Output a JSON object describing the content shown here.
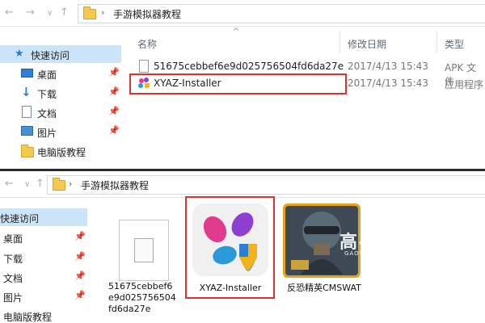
{
  "top": {
    "breadcrumb": {
      "separator": "›",
      "folder": "手游模拟器教程"
    },
    "sidebar": [
      {
        "label": "快速访问",
        "icon": "star-icon",
        "selected": true
      },
      {
        "label": "桌面",
        "icon": "desktop-icon",
        "pinned": true
      },
      {
        "label": "下载",
        "icon": "download-icon",
        "pinned": true
      },
      {
        "label": "文档",
        "icon": "document-icon",
        "pinned": true
      },
      {
        "label": "图片",
        "icon": "pictures-icon",
        "pinned": true
      },
      {
        "label": "电脑版教程",
        "icon": "folder-icon",
        "pinned": false
      }
    ],
    "columns": {
      "name": "名称",
      "date": "修改日期",
      "type": "类型"
    },
    "files": [
      {
        "name": "51675cebbef6e9d025756504fd6da27e",
        "date": "2017/4/13 15:43",
        "type": "APK 文件",
        "icon": "blank-file-icon"
      },
      {
        "name": "XYAZ-Installer",
        "date": "2017/4/13 15:43",
        "type": "应用程序",
        "icon": "xyaz-app-icon",
        "highlighted": true
      }
    ]
  },
  "bottom": {
    "breadcrumb": {
      "separator": "›",
      "folder": "手游模拟器教程"
    },
    "sidebar": [
      {
        "label": "快速访问",
        "selected": true
      },
      {
        "label": "桌面",
        "pinned": true
      },
      {
        "label": "下载",
        "pinned": true
      },
      {
        "label": "文档",
        "pinned": true
      },
      {
        "label": "图片",
        "pinned": true
      },
      {
        "label": "电脑版教程",
        "pinned": false
      }
    ],
    "tiles": [
      {
        "label": "51675cebbef6e9d025756504fd6da27e",
        "icon": "blank-file-icon"
      },
      {
        "label": "XYAZ-Installer",
        "icon": "xyaz-app-icon",
        "highlighted": true
      },
      {
        "label": "反恐精英CMSWAT",
        "icon": "cs-game-icon"
      }
    ],
    "watermark": {
      "brand": "高手游",
      "domain": "GAOSHOUYOU.COM"
    }
  },
  "colors": {
    "highlight": "#e0312e",
    "selected_bg": "#cce4f7",
    "folder": "#f4c94f"
  }
}
